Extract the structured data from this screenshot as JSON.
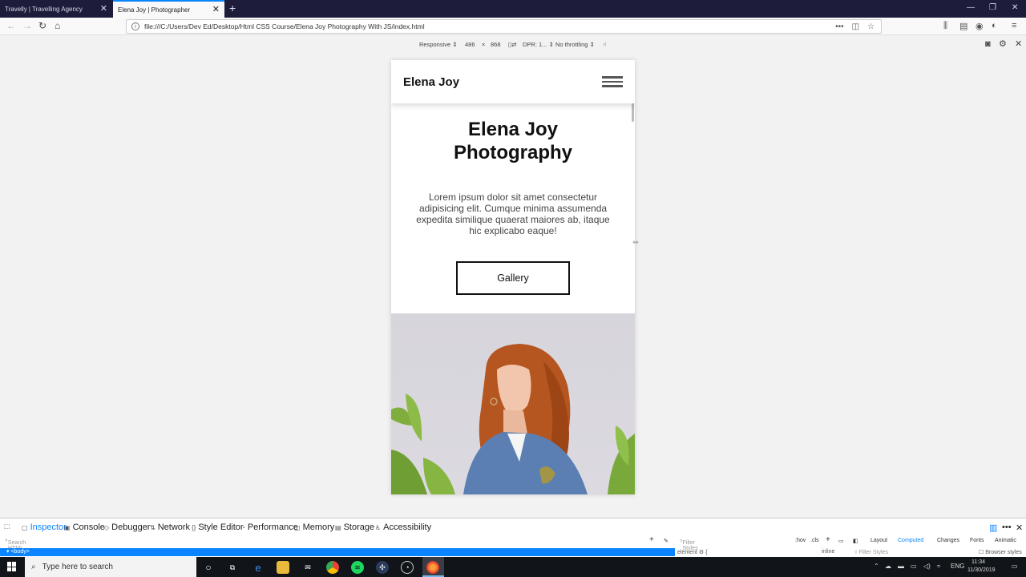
{
  "browser": {
    "tabs": [
      {
        "title": "Travelly | Travelling Agency",
        "active": false
      },
      {
        "title": "Elena Joy | Photographer",
        "active": true
      }
    ],
    "url": "file:///C:/Users/Dev Ed/Desktop/Html CSS Course/Elena Joy Photography With JS/index.html"
  },
  "responsive": {
    "device": "Responsive",
    "width": "486",
    "times": "×",
    "height": "868",
    "dpr": "DPR: 1...",
    "throttling": "No throttling"
  },
  "site": {
    "logo": "Elena Joy",
    "title": "Elena Joy Photography",
    "text": "Lorem ipsum dolor sit amet consectetur adipisicing elit. Cumque minima assumenda expedita similique quaerat maiores ab, itaque hic explicabo eaque!",
    "button": "Gallery"
  },
  "devtools": {
    "tabs": [
      "Inspector",
      "Console",
      "Debugger",
      "Network",
      "Style Editor",
      "Performance",
      "Memory",
      "Storage",
      "Accessibility"
    ],
    "search_placeholder": "Search HTML",
    "filter_styles": "Filter Styles",
    "hov": ":hov",
    "cls": ".cls",
    "side_tabs": [
      "Layout",
      "Computed",
      "Changes",
      "Fonts",
      "Animatic"
    ],
    "selected_node": "<body>",
    "element_rule": "element",
    "inline": "inline",
    "browser_styles": "Browser styles"
  },
  "taskbar": {
    "search_placeholder": "Type here to search",
    "lang": "ENG",
    "time": "11:34",
    "date": "11/30/2019"
  }
}
